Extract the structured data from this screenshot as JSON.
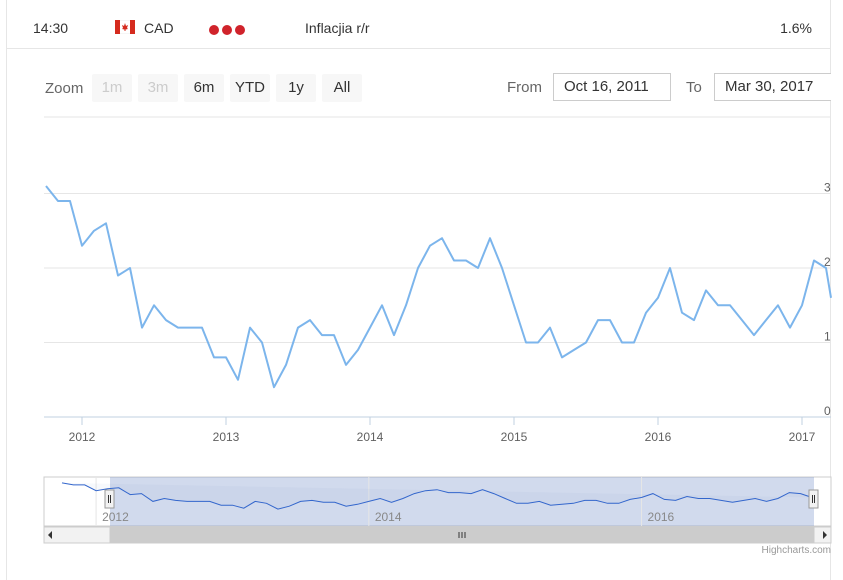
{
  "row": {
    "time": "14:30",
    "currency": "CAD",
    "event": "Inflacjia r/r",
    "value": "1.6%",
    "importance_dots": 3,
    "importance_color": "#d0232b"
  },
  "range_selector": {
    "zoom_label": "Zoom",
    "buttons": [
      {
        "label": "1m",
        "enabled": false
      },
      {
        "label": "3m",
        "enabled": false
      },
      {
        "label": "6m",
        "enabled": true
      },
      {
        "label": "YTD",
        "enabled": true
      },
      {
        "label": "1y",
        "enabled": true
      },
      {
        "label": "All",
        "enabled": true
      }
    ],
    "from_label": "From",
    "from_value": "Oct 16, 2011",
    "to_label": "To",
    "to_value": "Mar 30, 2017"
  },
  "chart_data": {
    "type": "line",
    "title": "",
    "xlabel": "",
    "ylabel": "",
    "x_start": "2011-10",
    "ylim": [
      0,
      3.3
    ],
    "y_ticks": [
      0,
      1,
      2,
      3
    ],
    "x_tick_labels": [
      "2012",
      "2013",
      "2014",
      "2015",
      "2016",
      "2017"
    ],
    "grid": true,
    "line_color": "#7cb5ec",
    "series": [
      {
        "values": [
          3.1,
          2.9,
          2.9,
          2.3,
          2.5,
          2.6,
          1.9,
          2.0,
          1.2,
          1.5,
          1.3,
          1.2,
          1.2,
          1.2,
          0.8,
          0.8,
          0.5,
          1.2,
          1.0,
          0.4,
          0.7,
          1.2,
          1.3,
          1.1,
          1.1,
          0.7,
          0.9,
          1.2,
          1.5,
          1.1,
          1.5,
          2.0,
          2.3,
          2.4,
          2.1,
          2.1,
          2.0,
          2.4,
          2.0,
          1.5,
          1.0,
          1.0,
          1.2,
          0.8,
          0.9,
          1.0,
          1.3,
          1.3,
          1.0,
          1.0,
          1.4,
          1.6,
          2.0,
          1.4,
          1.3,
          1.7,
          1.5,
          1.5,
          1.3,
          1.1,
          1.3,
          1.5,
          1.2,
          1.5,
          2.1,
          2.0,
          1.6
        ]
      }
    ],
    "navigator": {
      "tick_labels": [
        "2012",
        "2014",
        "2016"
      ]
    }
  },
  "credits": "Highcharts.com"
}
